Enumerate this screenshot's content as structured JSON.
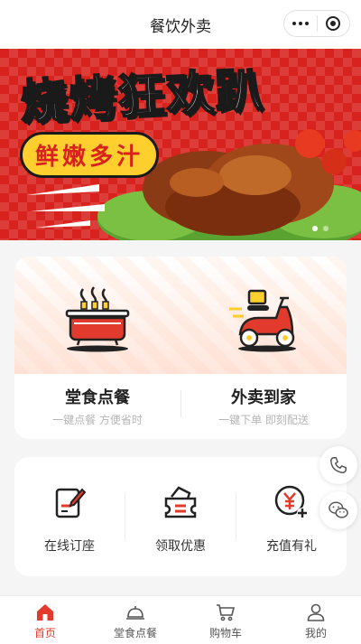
{
  "navbar": {
    "title": "餐饮外卖"
  },
  "banner": {
    "headline": "烧烤狂欢趴",
    "tag": "鲜嫩多汁",
    "slides": 2,
    "active_slide": 0
  },
  "services": [
    {
      "name": "堂食点餐",
      "subtitle": "一键点餐 方便省时",
      "icon": "hotpot-icon"
    },
    {
      "name": "外卖到家",
      "subtitle": "一键下单 即刻配送",
      "icon": "scooter-icon"
    }
  ],
  "features": [
    {
      "label": "在线订座",
      "icon": "reservation-icon"
    },
    {
      "label": "领取优惠",
      "icon": "coupon-icon"
    },
    {
      "label": "充值有礼",
      "icon": "recharge-icon"
    }
  ],
  "floating": [
    {
      "icon": "phone-icon"
    },
    {
      "icon": "wechat-icon"
    }
  ],
  "tabbar": {
    "items": [
      {
        "label": "首页",
        "icon": "home-icon"
      },
      {
        "label": "堂食点餐",
        "icon": "dine-in-icon"
      },
      {
        "label": "购物车",
        "icon": "cart-icon"
      },
      {
        "label": "我的",
        "icon": "user-icon"
      }
    ],
    "active_index": 0
  },
  "colors": {
    "accent": "#e23b2e",
    "banner_red": "#d8221d",
    "banner_yellow": "#ffcf2e"
  }
}
